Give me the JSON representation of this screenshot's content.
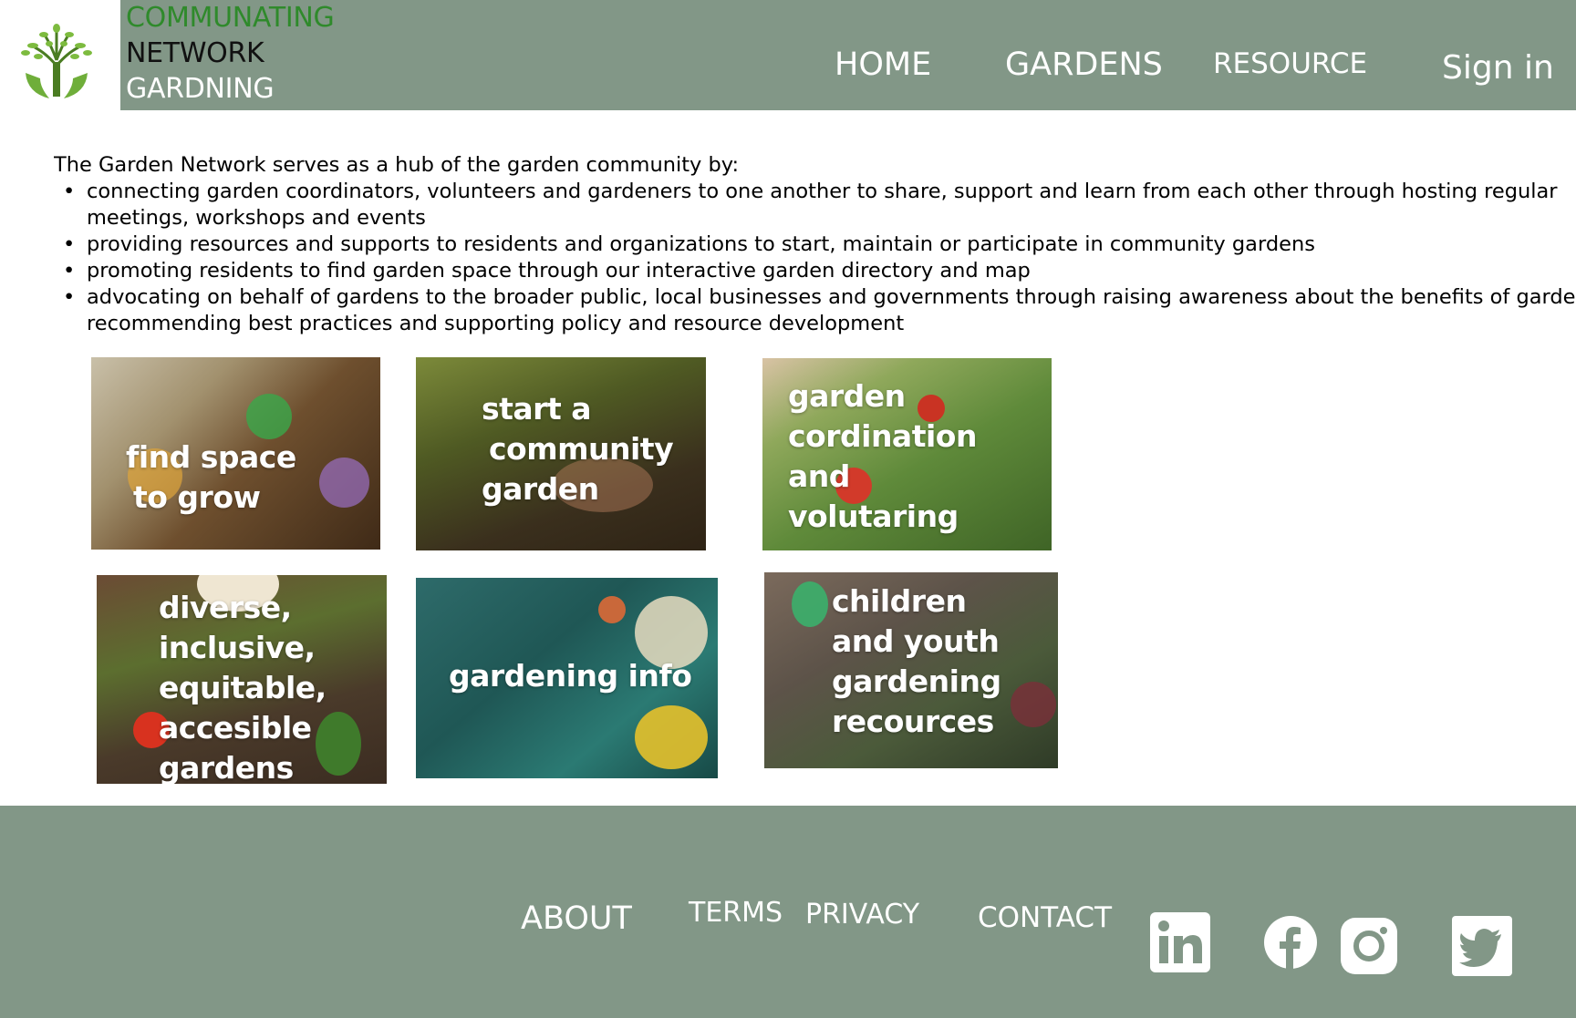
{
  "header": {
    "brand_line1": "COMMUNATING",
    "brand_line2": "NETWORK",
    "brand_line3": "GARDNING",
    "nav": {
      "home": "HOME",
      "gardens": "GARDENS",
      "resource": "RESOURCE",
      "sign_in": "Sign in"
    }
  },
  "intro": {
    "lead": "The Garden Network serves as a hub of the garden community by:",
    "bullets": [
      "connecting garden coordinators, volunteers and gardeners to one another to share, support and learn from each other through hosting regular",
      "meetings, workshops and events",
      "providing resources and supports to residents and organizations to start, maintain or participate in community gardens",
      "promoting residents to find garden space through our interactive garden directory and map",
      "advocating on behalf of gardens to the broader public, local businesses and governments through raising awareness about the benefits of gardens,",
      "recommending best practices and supporting policy and resource development"
    ]
  },
  "tiles": [
    {
      "lines": [
        "find space",
        "to grow"
      ]
    },
    {
      "lines": [
        "start a",
        "community",
        "garden"
      ]
    },
    {
      "lines": [
        "garden",
        "cordination",
        "and",
        "volutaring"
      ]
    },
    {
      "lines": [
        "diverse,",
        "inclusive,",
        "equitable,",
        "accesible",
        "gardens"
      ]
    },
    {
      "lines": [
        "gardening info"
      ]
    },
    {
      "lines": [
        "children",
        "and youth",
        "gardening",
        "recources"
      ]
    }
  ],
  "footer": {
    "about": "ABOUT",
    "terms": "TERMS",
    "privacy": "PRIVACY",
    "contact": "CONTACT",
    "social_icons": [
      "linkedin-icon",
      "facebook-icon",
      "instagram-icon",
      "twitter-icon"
    ]
  },
  "colors": {
    "header_bg": "#829787",
    "footer_bg": "#829787",
    "brand_green": "#2f8a2b",
    "nav_text": "#ffffff"
  }
}
